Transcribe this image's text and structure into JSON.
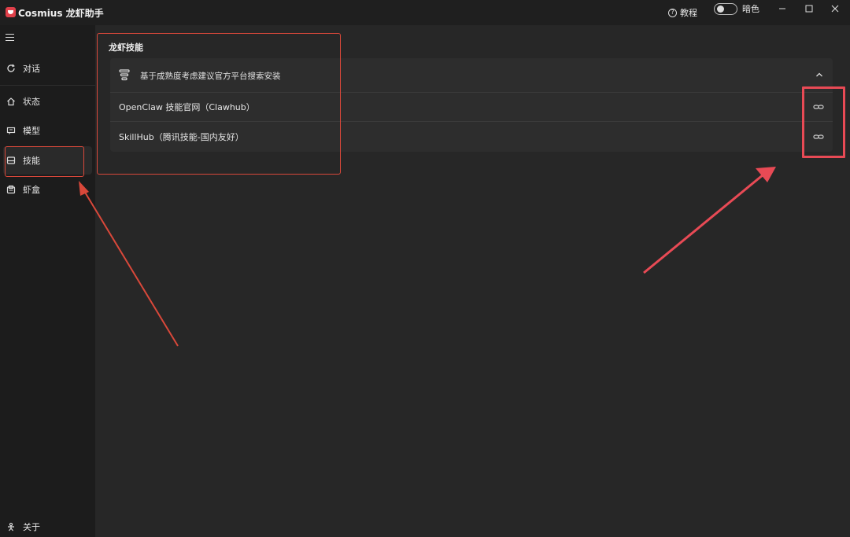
{
  "app": {
    "title": "Cosmius 龙虾助手"
  },
  "titlebar": {
    "help_label": "教程",
    "theme_toggle_label": "暗色",
    "minimize_icon": "minimize-icon",
    "maximize_icon": "maximize-icon",
    "close_icon": "close-icon"
  },
  "sidebar": {
    "items": [
      {
        "label": "对话",
        "icon": "refresh-chat-icon",
        "active": false
      },
      {
        "label": "状态",
        "icon": "home-icon",
        "active": false
      },
      {
        "label": "模型",
        "icon": "model-icon",
        "active": false
      },
      {
        "label": "技能",
        "icon": "skills-icon",
        "active": true
      },
      {
        "label": "虾盒",
        "icon": "box-icon",
        "active": false
      }
    ],
    "about_label": "关于"
  },
  "main": {
    "section_title": "龙虾技能",
    "panel": {
      "description": "基于成熟度考虑建议官方平台搜索安装",
      "expanded": true,
      "rows": [
        {
          "label": "OpenClaw 技能官网（Clawhub）",
          "action_icon": "link-icon"
        },
        {
          "label": "SkillHub（腾讯技能-国内友好）",
          "action_icon": "link-icon"
        }
      ]
    }
  },
  "colors": {
    "annotation_orange": "#d9483a",
    "annotation_red": "#e84a55",
    "brand_red": "#e0404a"
  }
}
